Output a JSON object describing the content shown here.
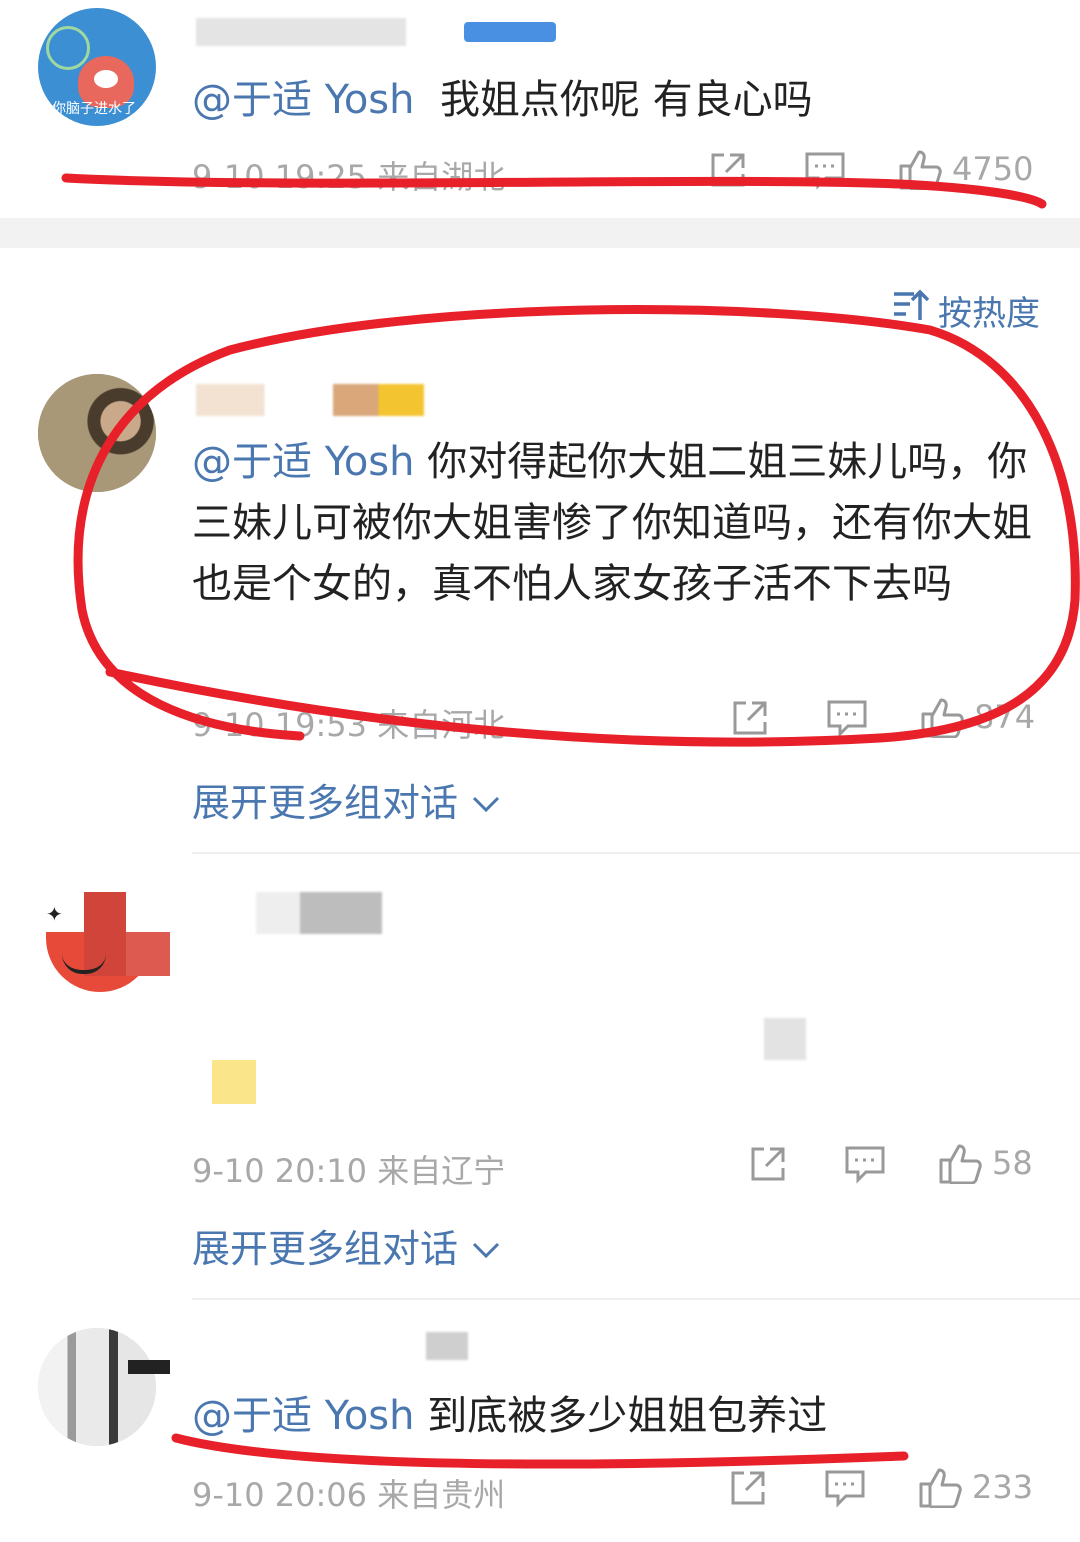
{
  "sort": {
    "label": "按热度"
  },
  "comments": [
    {
      "mention": "@于适 Yosh",
      "text": "我姐点你呢 有良心吗",
      "time": "9-10 19:25",
      "location": "来自湖北",
      "likes": "4750",
      "avatar_text": "你脑子进水了"
    },
    {
      "mention": "@于适 Yosh",
      "text": "你对得起你大姐二姐三妹儿吗，你三妹儿可被你大姐害惨了你知道吗，还有你大姐也是个女的，真不怕人家女孩子活不下去吗",
      "time": "9-10 19:53",
      "location": "来自河北",
      "likes": "874"
    },
    {
      "time": "9-10 20:10",
      "location": "来自辽宁",
      "likes": "58"
    },
    {
      "mention": "@于适 Yosh",
      "text": "到底被多少姐姐包养过",
      "time": "9-10 20:06",
      "location": "来自贵州",
      "likes": "233"
    }
  ],
  "expand_label": "展开更多组对话",
  "icons": [
    "share-icon",
    "comment-icon",
    "like-icon",
    "sort-icon",
    "chevron-down-icon"
  ],
  "colors": {
    "mention": "#4a77b0",
    "meta": "#a8a8a8",
    "annotation": "#e8202a"
  }
}
